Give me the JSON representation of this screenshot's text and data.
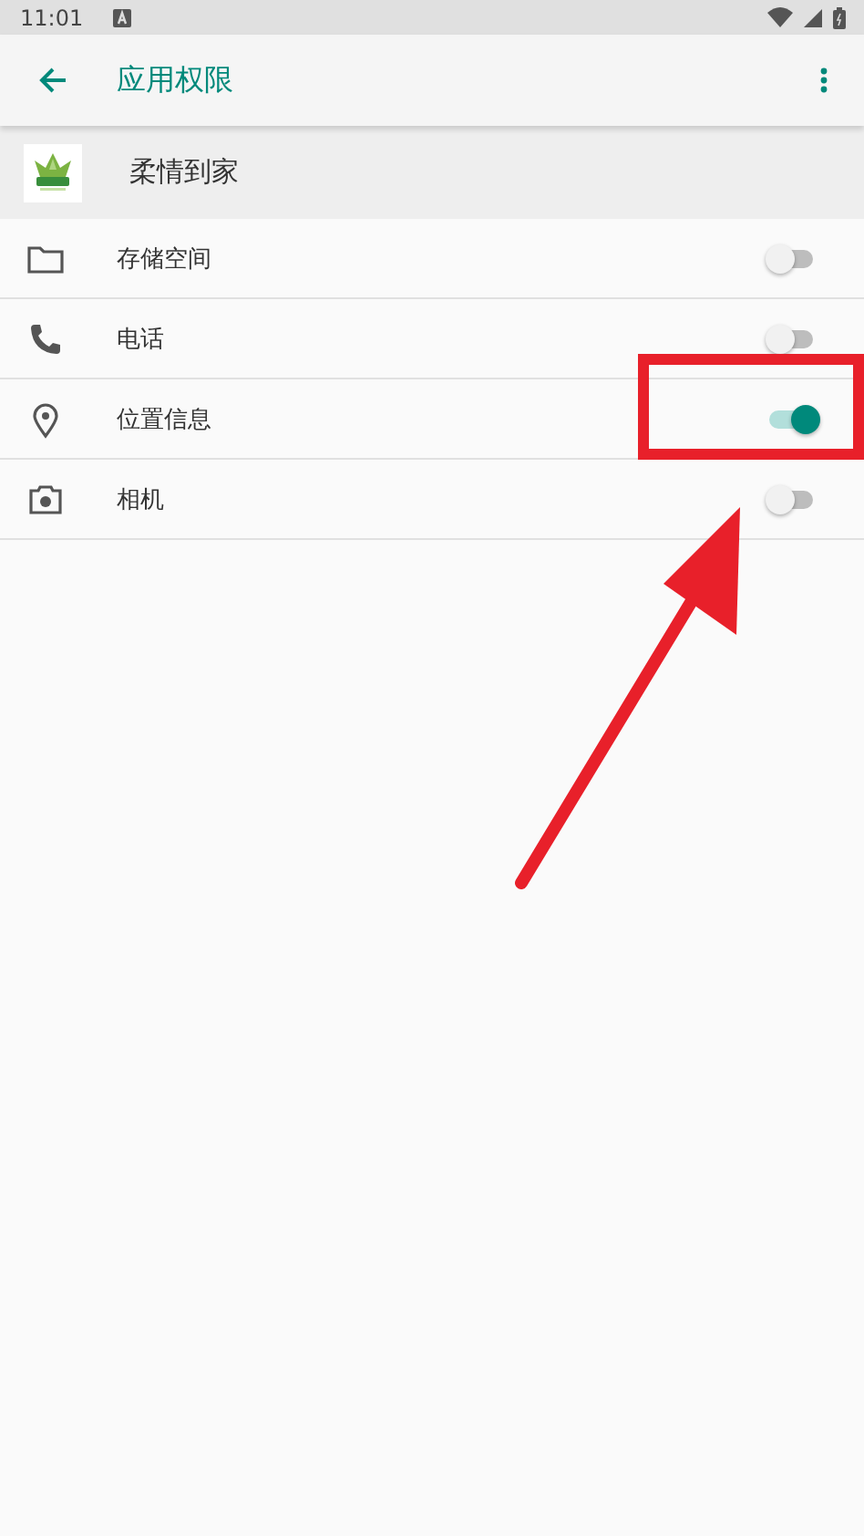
{
  "status_bar": {
    "time": "11:01"
  },
  "app_bar": {
    "title": "应用权限"
  },
  "app": {
    "name": "柔情到家"
  },
  "permissions": [
    {
      "label": "存储空间",
      "on": false
    },
    {
      "label": "电话",
      "on": false
    },
    {
      "label": "位置信息",
      "on": true
    },
    {
      "label": "相机",
      "on": false
    }
  ]
}
